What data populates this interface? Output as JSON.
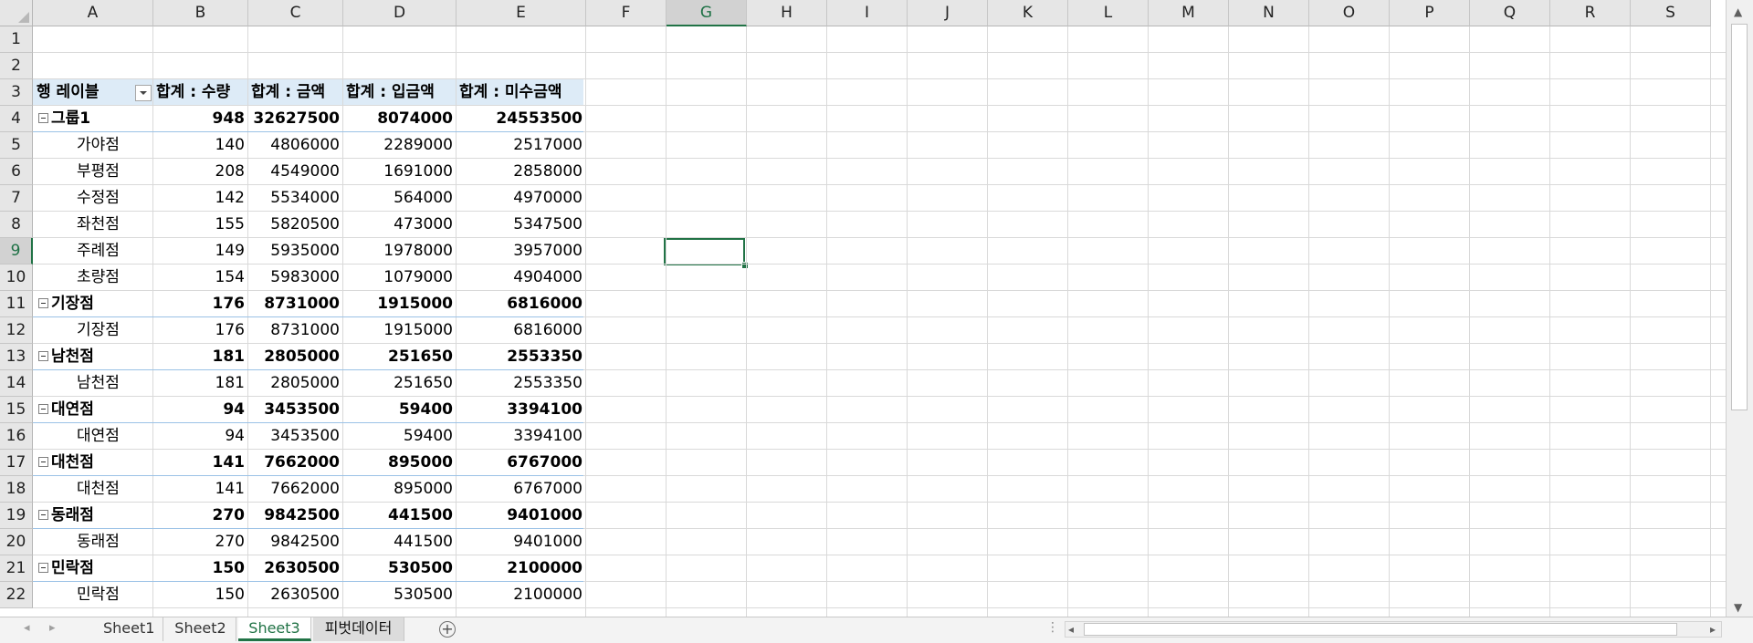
{
  "columns": [
    "A",
    "B",
    "C",
    "D",
    "E",
    "F",
    "G",
    "H",
    "I",
    "J",
    "K",
    "L",
    "M",
    "N",
    "O",
    "P",
    "Q",
    "R",
    "S"
  ],
  "selected_column": "G",
  "selected_row": "9",
  "rows": [
    "1",
    "2",
    "3",
    "4",
    "5",
    "6",
    "7",
    "8",
    "9",
    "10",
    "11",
    "12",
    "13",
    "14",
    "15",
    "16",
    "17",
    "18",
    "19",
    "20",
    "21",
    "22"
  ],
  "pivot": {
    "headers": [
      "행 레이블",
      "합계 : 수량",
      "합계 : 금액",
      "합계 : 입금액",
      "합계 : 미수금액"
    ],
    "data_rows": [
      {
        "label": "그룹1",
        "qty": "948",
        "amount": "32627500",
        "paid": "8074000",
        "unpaid": "24553500",
        "group": true
      },
      {
        "label": "가야점",
        "qty": "140",
        "amount": "4806000",
        "paid": "2289000",
        "unpaid": "2517000",
        "group": false
      },
      {
        "label": "부평점",
        "qty": "208",
        "amount": "4549000",
        "paid": "1691000",
        "unpaid": "2858000",
        "group": false
      },
      {
        "label": "수정점",
        "qty": "142",
        "amount": "5534000",
        "paid": "564000",
        "unpaid": "4970000",
        "group": false
      },
      {
        "label": "좌천점",
        "qty": "155",
        "amount": "5820500",
        "paid": "473000",
        "unpaid": "5347500",
        "group": false
      },
      {
        "label": "주례점",
        "qty": "149",
        "amount": "5935000",
        "paid": "1978000",
        "unpaid": "3957000",
        "group": false
      },
      {
        "label": "초량점",
        "qty": "154",
        "amount": "5983000",
        "paid": "1079000",
        "unpaid": "4904000",
        "group": false
      },
      {
        "label": "기장점",
        "qty": "176",
        "amount": "8731000",
        "paid": "1915000",
        "unpaid": "6816000",
        "group": true
      },
      {
        "label": "기장점",
        "qty": "176",
        "amount": "8731000",
        "paid": "1915000",
        "unpaid": "6816000",
        "group": false
      },
      {
        "label": "남천점",
        "qty": "181",
        "amount": "2805000",
        "paid": "251650",
        "unpaid": "2553350",
        "group": true
      },
      {
        "label": "남천점",
        "qty": "181",
        "amount": "2805000",
        "paid": "251650",
        "unpaid": "2553350",
        "group": false
      },
      {
        "label": "대연점",
        "qty": "94",
        "amount": "3453500",
        "paid": "59400",
        "unpaid": "3394100",
        "group": true
      },
      {
        "label": "대연점",
        "qty": "94",
        "amount": "3453500",
        "paid": "59400",
        "unpaid": "3394100",
        "group": false
      },
      {
        "label": "대천점",
        "qty": "141",
        "amount": "7662000",
        "paid": "895000",
        "unpaid": "6767000",
        "group": true
      },
      {
        "label": "대천점",
        "qty": "141",
        "amount": "7662000",
        "paid": "895000",
        "unpaid": "6767000",
        "group": false
      },
      {
        "label": "동래점",
        "qty": "270",
        "amount": "9842500",
        "paid": "441500",
        "unpaid": "9401000",
        "group": true
      },
      {
        "label": "동래점",
        "qty": "270",
        "amount": "9842500",
        "paid": "441500",
        "unpaid": "9401000",
        "group": false
      },
      {
        "label": "민락점",
        "qty": "150",
        "amount": "2630500",
        "paid": "530500",
        "unpaid": "2100000",
        "group": true
      },
      {
        "label": "민락점",
        "qty": "150",
        "amount": "2630500",
        "paid": "530500",
        "unpaid": "2100000",
        "group": false
      }
    ]
  },
  "sheet_tabs": [
    {
      "label": "Sheet1",
      "active": false
    },
    {
      "label": "Sheet2",
      "active": false
    },
    {
      "label": "Sheet3",
      "active": true
    },
    {
      "label": "피벗데이터",
      "active": false
    }
  ],
  "icons": {
    "add_sheet": "+",
    "prev_sheet": "◂",
    "next_sheet": "▸",
    "scroll_up": "▲",
    "scroll_down": "▼",
    "scroll_left": "◂",
    "scroll_right": "▸",
    "dots": "⋮"
  },
  "colors": {
    "accent": "#217346",
    "pivot_header": "#ddebf7",
    "pivot_line": "#9bc2e6"
  }
}
